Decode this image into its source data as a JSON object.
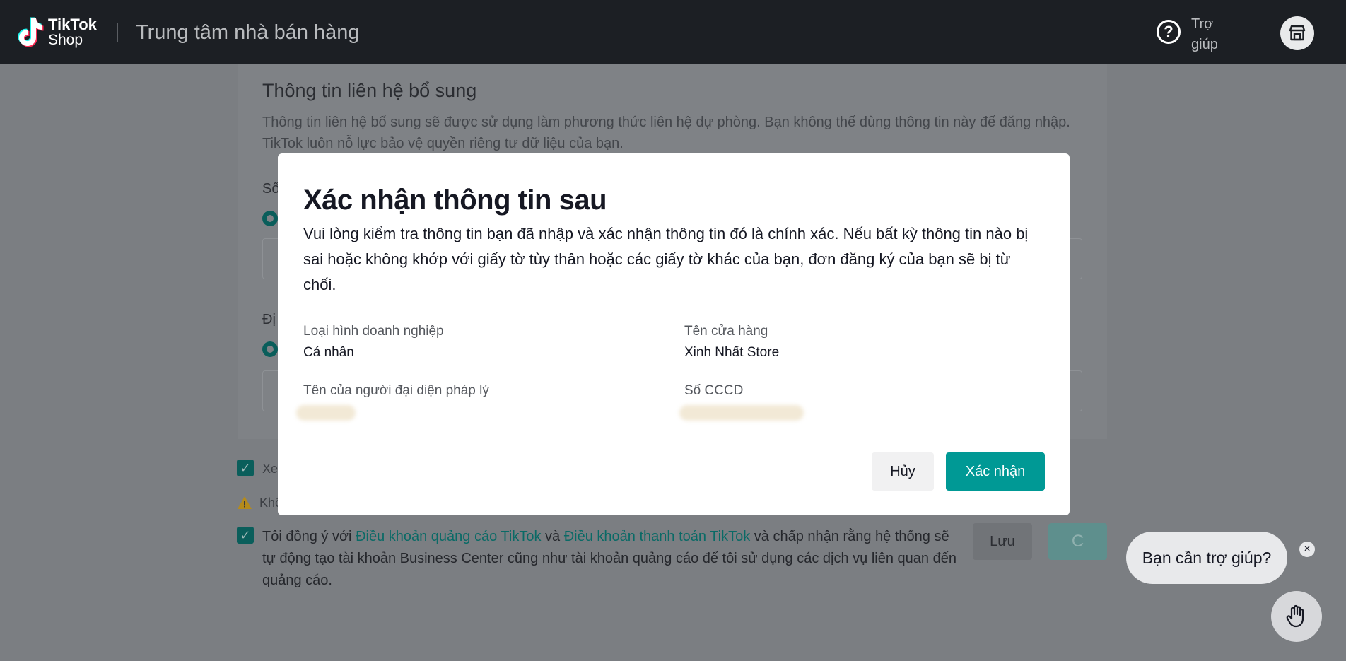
{
  "header": {
    "brand_line1": "TikTok",
    "brand_line2": "Shop",
    "app_title": "Trung tâm nhà bán hàng",
    "help_symbol": "?",
    "help_label": "Trợ giúp"
  },
  "background": {
    "section_title": "Thông tin liên hệ bổ sung",
    "section_desc": "Thông tin liên hệ bổ sung sẽ được sử dụng làm phương thức liên hệ dự phòng. Bạn không thể dùng thông tin này để đăng nhập. TikTok luôn nỗ lực bảo vệ quyền riêng tư dữ liệu của bạn.",
    "frag_phone": "Số",
    "frag_address": "Đị",
    "frag_review": "Xe",
    "frag_warning": "Khô",
    "agree_prefix": "Tôi đồng ý với ",
    "agree_link1": "Điều khoản quảng cáo TikTok",
    "agree_mid": " và ",
    "agree_link2": "Điều khoản thanh toán TikTok",
    "agree_suffix": " và chấp nhận rằng hệ thống sẽ tự động tạo tài khoản Business Center cũng như tài khoản quảng cáo để tôi sử dụng các dịch vụ liên quan đến quảng cáo.",
    "save_label": "Lưu",
    "next_label": "C"
  },
  "modal": {
    "title": "Xác nhận thông tin sau",
    "description": "Vui lòng kiểm tra thông tin bạn đã nhập và xác nhận thông tin đó là chính xác. Nếu bất kỳ thông tin nào bị sai hoặc không khớp với giấy tờ tùy thân hoặc các giấy tờ khác của bạn, đơn đăng ký của bạn sẽ bị từ chối.",
    "fields": [
      {
        "label": "Loại hình doanh nghiệp",
        "value": "Cá nhân"
      },
      {
        "label": "Tên cửa hàng",
        "value": "Xinh Nhất Store"
      },
      {
        "label": "Tên của người đại diện pháp lý",
        "value": ""
      },
      {
        "label": "Số CCCD",
        "value": ""
      }
    ],
    "cancel_label": "Hủy",
    "confirm_label": "Xác nhận"
  },
  "chat": {
    "prompt": "Bạn cần trợ giúp?",
    "close_symbol": "×"
  },
  "colors": {
    "accent": "#009995",
    "header_bg": "#1c1f24",
    "overlay": "#7b7e82"
  }
}
